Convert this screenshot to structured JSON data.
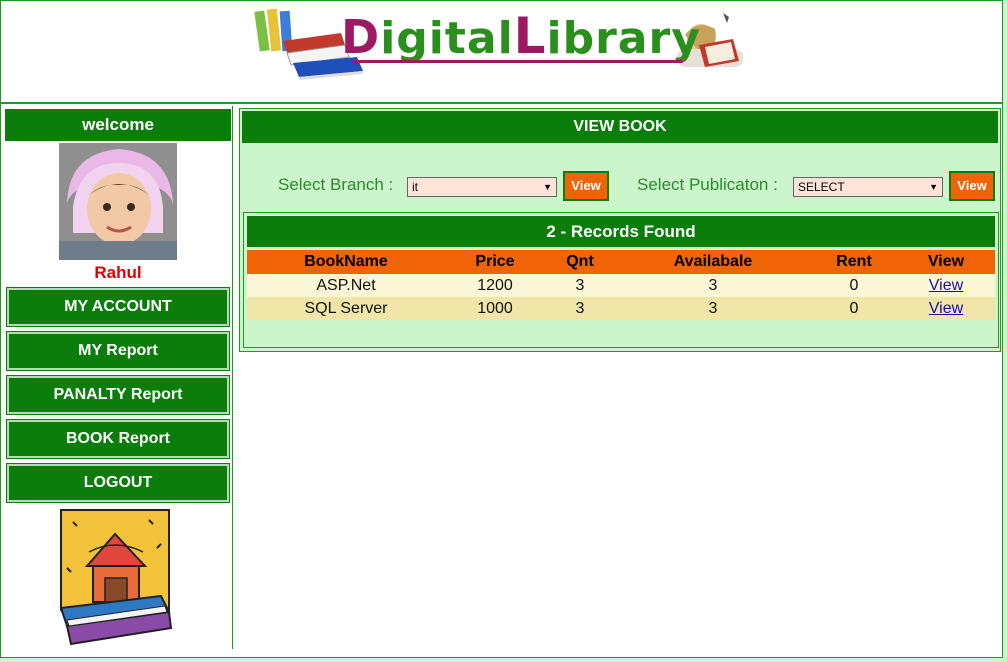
{
  "header": {
    "logo_parts": [
      "D",
      "igital",
      "L",
      "ibrary"
    ]
  },
  "sidebar": {
    "welcome": "welcome",
    "user_name": "Rahul",
    "items": [
      {
        "label": "MY ACCOUNT"
      },
      {
        "label": "MY Report"
      },
      {
        "label": "PANALTY Report"
      },
      {
        "label": "BOOK Report"
      },
      {
        "label": "LOGOUT"
      }
    ]
  },
  "main": {
    "title": "VIEW BOOK",
    "branch_label": "Select Branch :",
    "branch_value": "it",
    "branch_button": "View",
    "publication_label": "Select Publicaton :",
    "publication_value": "SELECT",
    "publication_button": "View",
    "records_text": "2 - Records Found",
    "table": {
      "headers": [
        "BookName",
        "Price",
        "Qnt",
        "Availabale",
        "Rent",
        "View"
      ],
      "rows": [
        [
          "ASP.Net",
          "1200",
          "3",
          "3",
          "0",
          "View"
        ],
        [
          "SQL Server",
          "1000",
          "3",
          "3",
          "0",
          "View"
        ]
      ]
    }
  },
  "colors": {
    "primary_green": "#0a7d0a",
    "accent_orange": "#f06408",
    "page_bg": "#ccf5cc",
    "logo_magenta": "#9b1a62",
    "logo_green": "#2b8f1d"
  }
}
